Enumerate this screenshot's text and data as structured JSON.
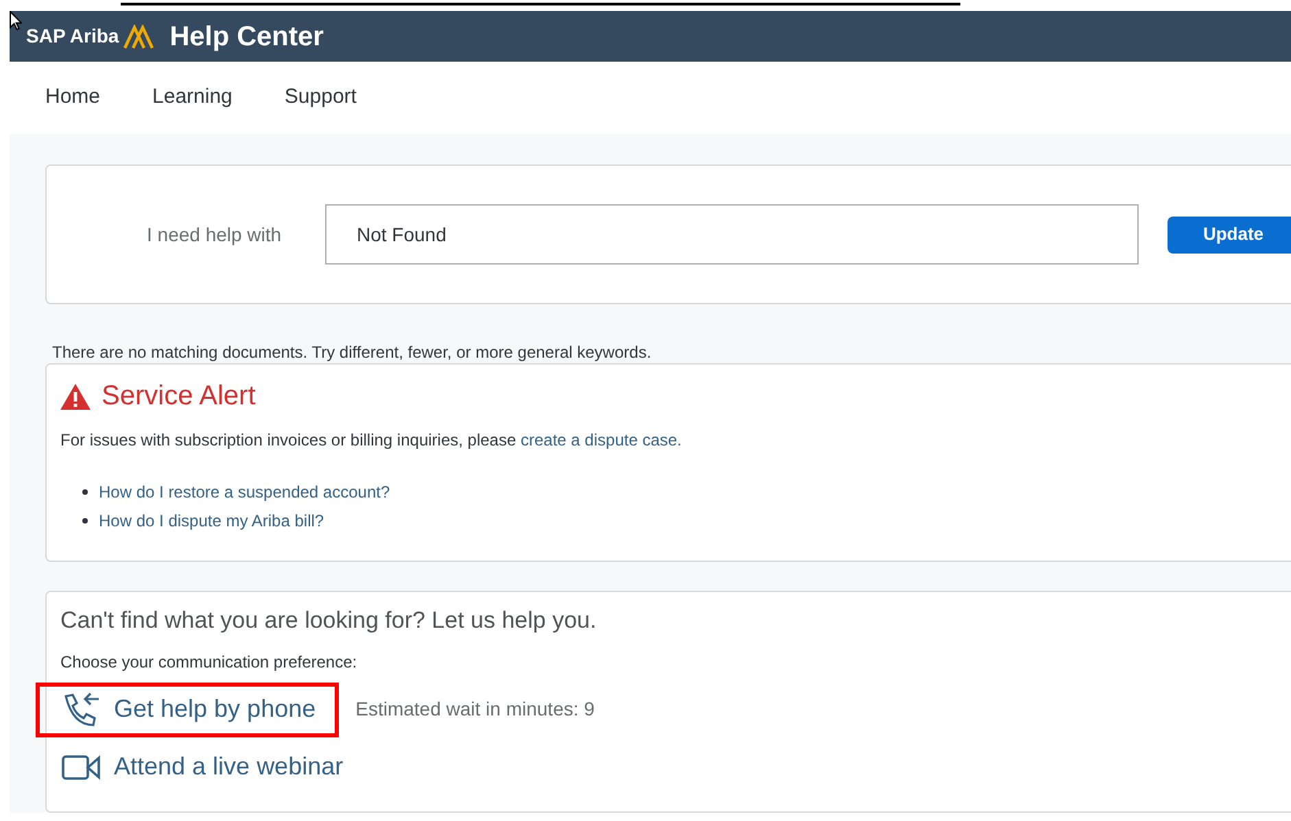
{
  "header": {
    "brand": "SAP Ariba",
    "title": "Help Center"
  },
  "nav": [
    {
      "label": "Home"
    },
    {
      "label": "Learning"
    },
    {
      "label": "Support"
    }
  ],
  "search": {
    "label": "I need help with",
    "value": "Not Found",
    "button": "Update"
  },
  "message": "There are no matching documents. Try different, fewer, or more general keywords.",
  "alert": {
    "title": "Service Alert",
    "text": "For issues with subscription invoices or billing inquiries, please",
    "link": "create a dispute case.",
    "links": [
      {
        "label": "How do I restore a suspended account?"
      },
      {
        "label": "How do I dispute my Ariba bill?"
      }
    ]
  },
  "contact": {
    "title": "Can't find what you are looking for? Let us help you.",
    "subtitle": "Choose your communication preference:",
    "options": [
      {
        "kind": "phone",
        "label": "Get help by phone",
        "note": "Estimated wait in minutes: 9",
        "highlighted": true
      },
      {
        "kind": "webinar",
        "label": "Attend a live webinar",
        "highlighted": false
      }
    ]
  }
}
